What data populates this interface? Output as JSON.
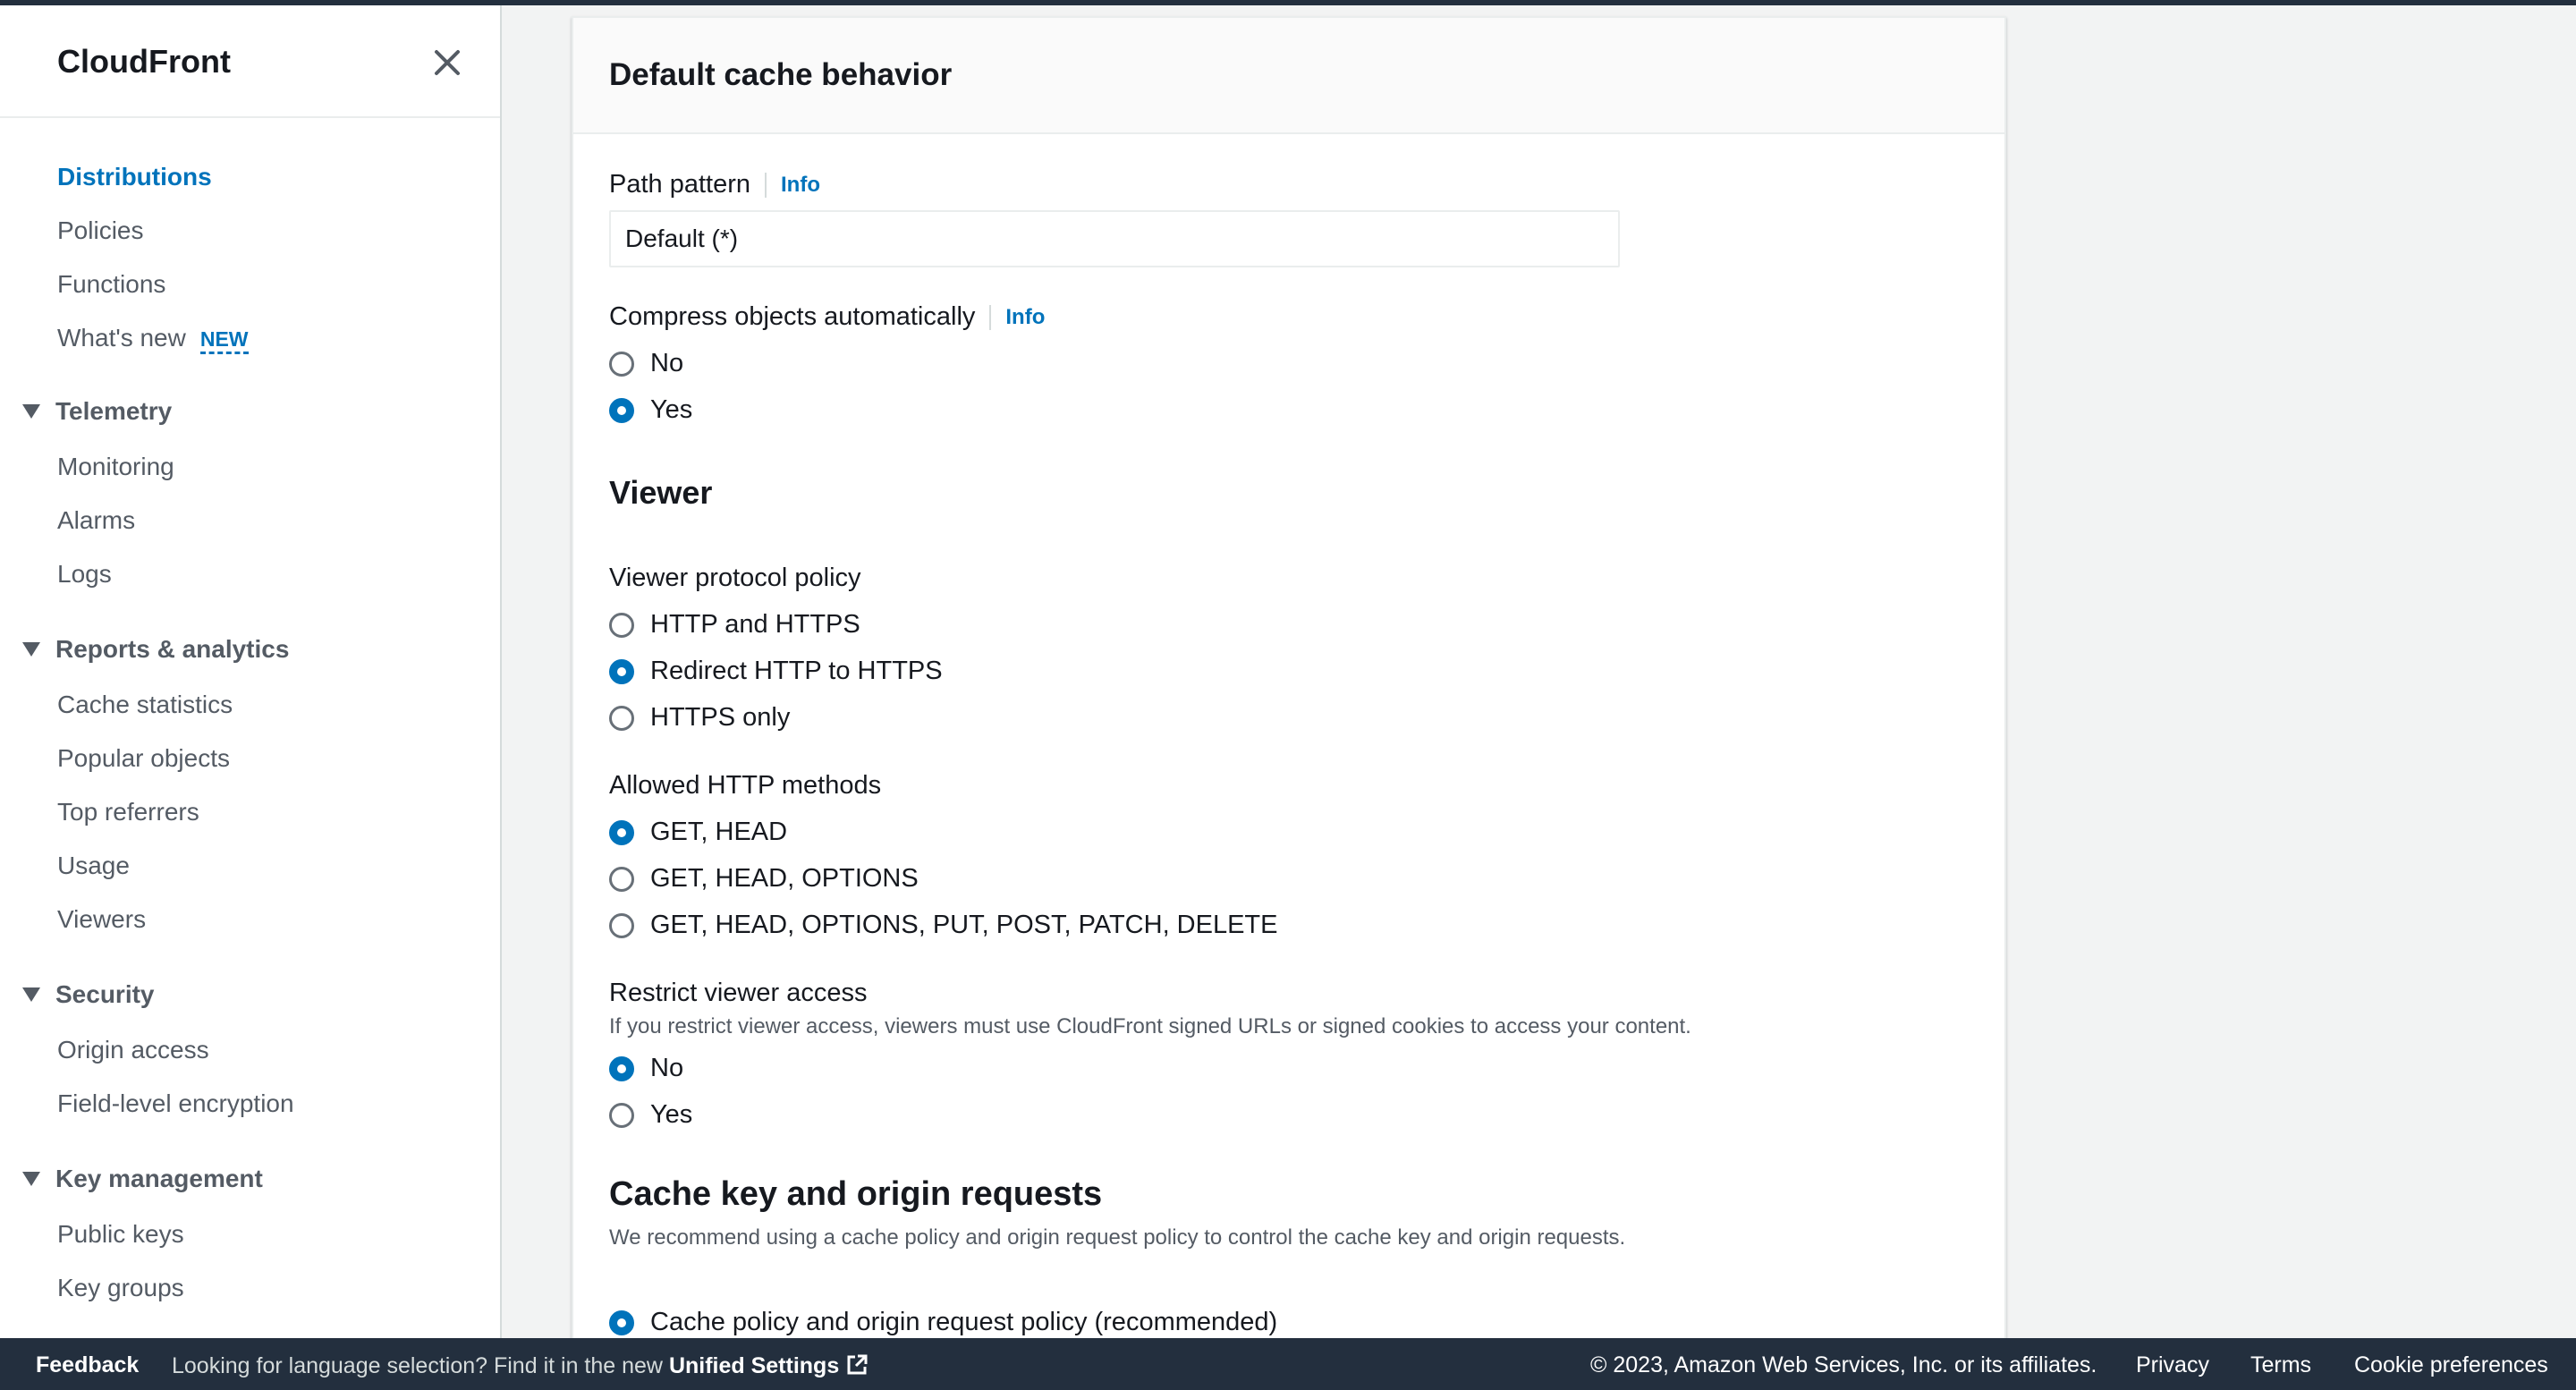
{
  "sidebar": {
    "title": "CloudFront",
    "items": [
      {
        "label": "Distributions",
        "active": true
      },
      {
        "label": "Policies"
      },
      {
        "label": "Functions"
      },
      {
        "label": "What's new",
        "badge": "NEW"
      }
    ],
    "sections": [
      {
        "label": "Telemetry",
        "items": [
          "Monitoring",
          "Alarms",
          "Logs"
        ]
      },
      {
        "label": "Reports & analytics",
        "items": [
          "Cache statistics",
          "Popular objects",
          "Top referrers",
          "Usage",
          "Viewers"
        ]
      },
      {
        "label": "Security",
        "items": [
          "Origin access",
          "Field-level encryption"
        ]
      },
      {
        "label": "Key management",
        "items": [
          "Public keys",
          "Key groups"
        ]
      }
    ]
  },
  "panel": {
    "title": "Default cache behavior",
    "path_pattern": {
      "label": "Path pattern",
      "info": "Info",
      "value": "Default (*)"
    },
    "compress": {
      "label": "Compress objects automatically",
      "info": "Info",
      "options": [
        "No",
        "Yes"
      ],
      "selected": "Yes"
    },
    "viewer_heading": "Viewer",
    "protocol": {
      "label": "Viewer protocol policy",
      "options": [
        "HTTP and HTTPS",
        "Redirect HTTP to HTTPS",
        "HTTPS only"
      ],
      "selected": "Redirect HTTP to HTTPS"
    },
    "methods": {
      "label": "Allowed HTTP methods",
      "options": [
        "GET, HEAD",
        "GET, HEAD, OPTIONS",
        "GET, HEAD, OPTIONS, PUT, POST, PATCH, DELETE"
      ],
      "selected": "GET, HEAD"
    },
    "restrict": {
      "label": "Restrict viewer access",
      "description": "If you restrict viewer access, viewers must use CloudFront signed URLs or signed cookies to access your content.",
      "options": [
        "No",
        "Yes"
      ],
      "selected": "No"
    },
    "cache_key": {
      "heading": "Cache key and origin requests",
      "description": "We recommend using a cache policy and origin request policy to control the cache key and origin requests.",
      "option": "Cache policy and origin request policy (recommended)",
      "selected": true
    }
  },
  "footer": {
    "feedback": "Feedback",
    "language_text": "Looking for language selection? Find it in the new",
    "unified_settings": "Unified Settings",
    "copyright": "© 2023, Amazon Web Services, Inc. or its affiliates.",
    "privacy": "Privacy",
    "terms": "Terms",
    "cookies": "Cookie preferences"
  },
  "colors": {
    "accent": "#0073bb",
    "footer_bg": "#232f3e",
    "text": "#16191f",
    "muted": "#545b64"
  }
}
